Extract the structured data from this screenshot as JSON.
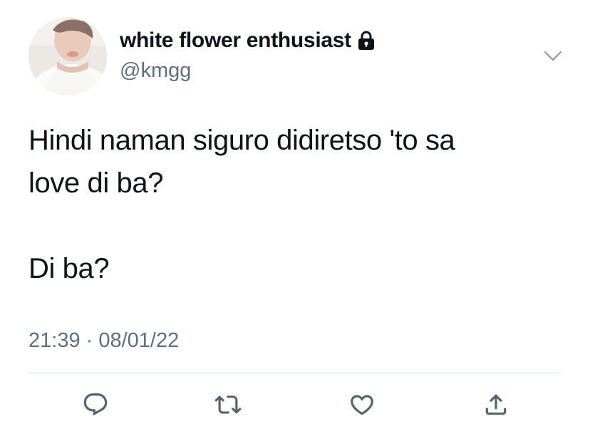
{
  "tweet": {
    "author": {
      "display_name": "white flower enthusiast",
      "handle": "@kmgg",
      "protected_icon": "lock-icon",
      "avatar_icon": "profile-photo"
    },
    "text_lines": [
      "Hindi naman siguro didiretso 'to sa",
      "love di ba?",
      "",
      "Di ba?"
    ],
    "timestamp": "21:39 · 08/01/22",
    "menu_icon": "chevron-down-icon",
    "actions": [
      {
        "name": "reply",
        "icon": "reply-icon"
      },
      {
        "name": "retweet",
        "icon": "retweet-icon"
      },
      {
        "name": "like",
        "icon": "heart-icon"
      },
      {
        "name": "share",
        "icon": "share-icon"
      }
    ],
    "colors": {
      "text": "#0f1419",
      "secondary": "#5b7083",
      "icon": "#657786",
      "divider": "#d6dde3"
    }
  }
}
